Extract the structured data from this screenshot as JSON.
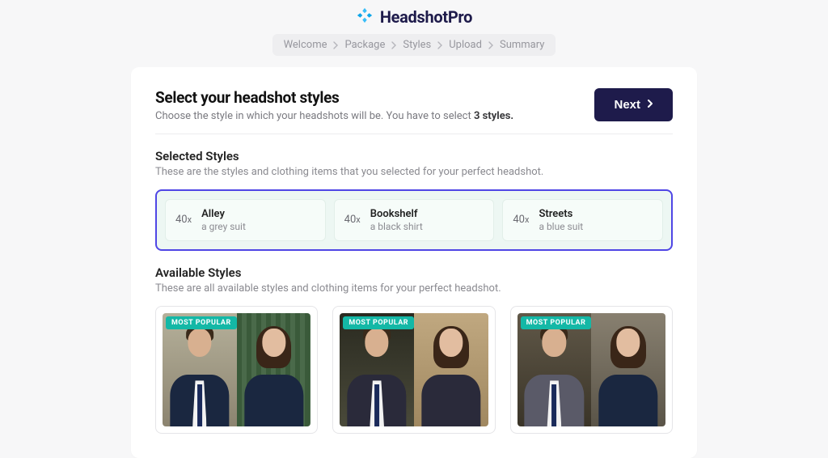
{
  "brand": {
    "name": "HeadshotPro"
  },
  "breadcrumb": [
    "Welcome",
    "Package",
    "Styles",
    "Upload",
    "Summary"
  ],
  "header": {
    "title": "Select your headshot styles",
    "subtitle_lead": "Choose the style in which your headshots will be. You have to select ",
    "subtitle_emph": "3 styles.",
    "next_label": "Next"
  },
  "selected_section": {
    "title": "Selected Styles",
    "subtitle": "These are the styles and clothing items that you selected for your perfect headshot.",
    "items": [
      {
        "count": "40",
        "suffix": "x",
        "name": "Alley",
        "desc": "a grey suit"
      },
      {
        "count": "40",
        "suffix": "x",
        "name": "Bookshelf",
        "desc": "a black shirt"
      },
      {
        "count": "40",
        "suffix": "x",
        "name": "Streets",
        "desc": "a blue suit"
      }
    ]
  },
  "available_section": {
    "title": "Available Styles",
    "subtitle": "These are all available styles and clothing items for your perfect headshot.",
    "badge": "MOST POPULAR"
  }
}
